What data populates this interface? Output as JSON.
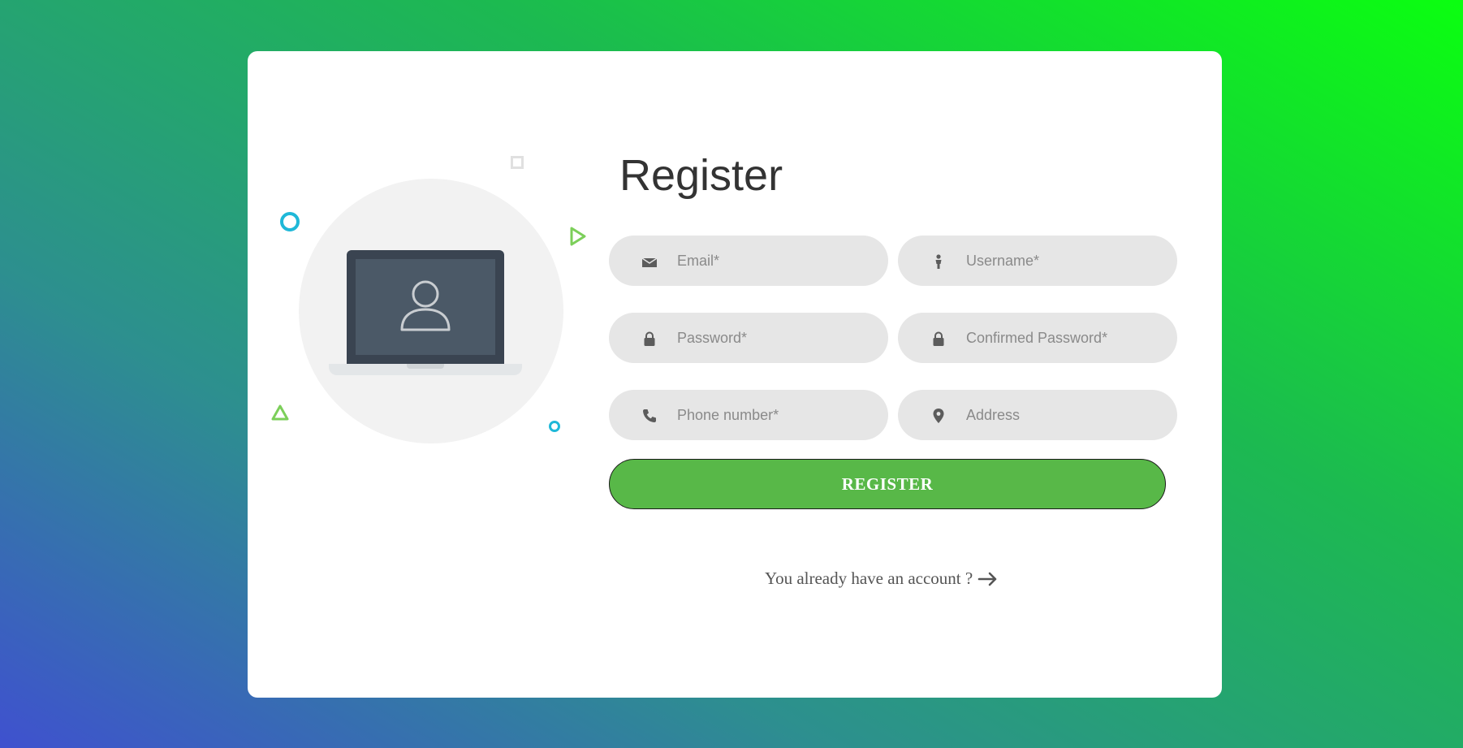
{
  "title": "Register",
  "fields": {
    "email": {
      "placeholder": "Email*",
      "icon": "envelope-icon"
    },
    "username": {
      "placeholder": "Username*",
      "icon": "person-icon"
    },
    "password": {
      "placeholder": "Password*",
      "icon": "lock-icon"
    },
    "confirm_password": {
      "placeholder": "Confirmed Password*",
      "icon": "lock-icon"
    },
    "phone": {
      "placeholder": "Phone number*",
      "icon": "phone-icon"
    },
    "address": {
      "placeholder": "Address",
      "icon": "map-pin-icon"
    }
  },
  "register_button": {
    "label": "REGISTER",
    "color": "#58b848"
  },
  "login_link": {
    "label": "You already have an account ?",
    "icon": "arrow-right-icon"
  },
  "colors": {
    "field_bg": "#e6e6e6",
    "accent_teal": "#1fb8d8",
    "accent_green": "#7ccf5a"
  }
}
